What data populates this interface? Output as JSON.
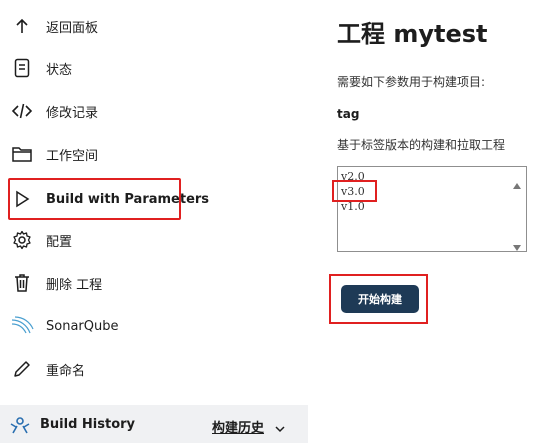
{
  "sidebar": {
    "items": [
      {
        "label": "返回面板",
        "icon": "arrow-up-icon"
      },
      {
        "label": "状态",
        "icon": "document-icon"
      },
      {
        "label": "修改记录",
        "icon": "code-icon"
      },
      {
        "label": "工作空间",
        "icon": "folder-icon"
      },
      {
        "label": "Build with Parameters",
        "icon": "play-icon"
      },
      {
        "label": "配置",
        "icon": "gear-icon"
      },
      {
        "label": "删除 工程",
        "icon": "trash-icon"
      },
      {
        "label": "SonarQube",
        "icon": "sonarqube-icon"
      },
      {
        "label": "重命名",
        "icon": "pencil-icon"
      }
    ],
    "build_history": {
      "title": "Build History",
      "link": "构建历史",
      "chevron": "chevron-down-icon"
    }
  },
  "main": {
    "title": "工程 mytest",
    "description": "需要如下参数用于构建项目:",
    "param": {
      "name": "tag",
      "description": "基于标签版本的构建和拉取工程",
      "options": [
        "v2.0",
        "v3.0",
        "v1.0"
      ],
      "selected": "v3.0"
    },
    "build_button": "开始构建"
  },
  "colors": {
    "highlight": "#e02020",
    "button": "#1e3a56",
    "history_bar": "#f0f1f3"
  }
}
